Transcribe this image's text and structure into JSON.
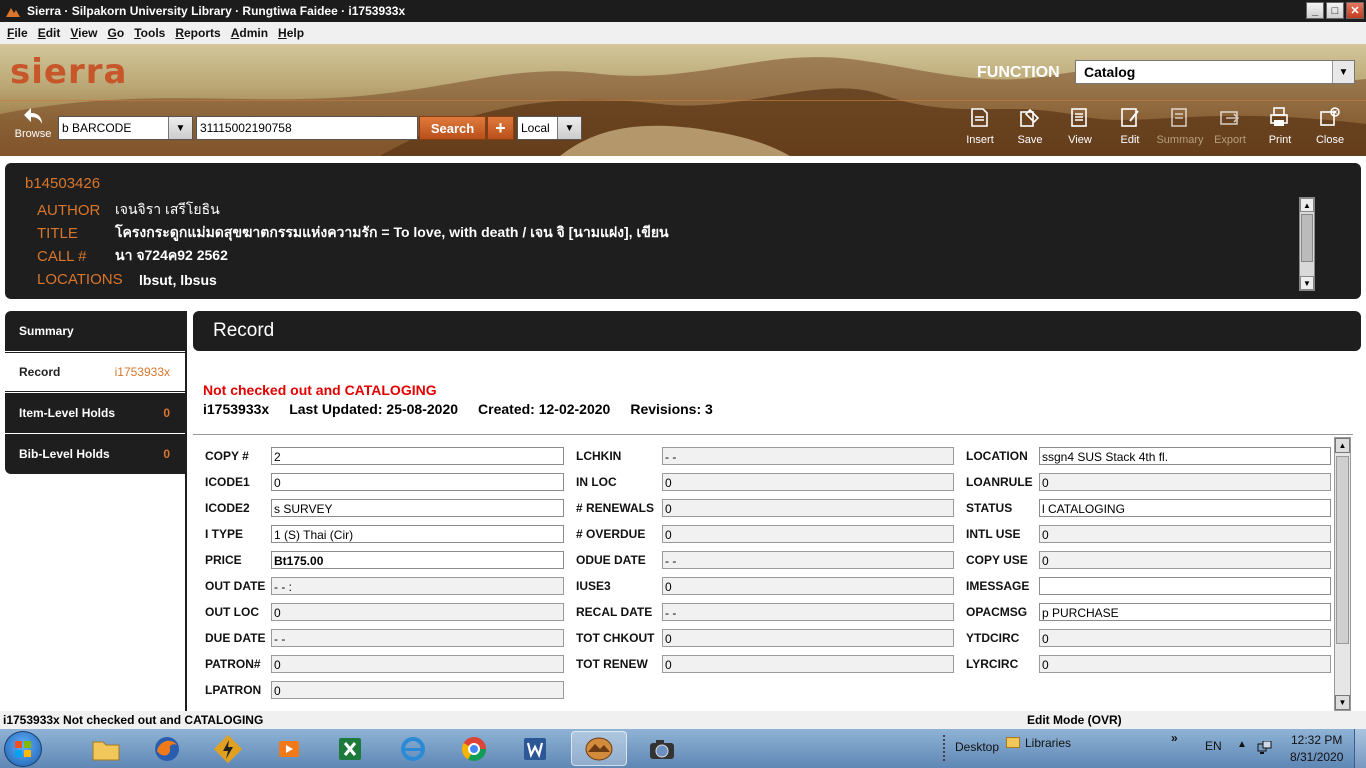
{
  "window": {
    "title": "Sierra · Silpakorn University Library · Rungtiwa Faidee · i1753933x",
    "min": "_",
    "max": "□",
    "close": "✕"
  },
  "menu": [
    {
      "label": "File",
      "key": "F"
    },
    {
      "label": "Edit",
      "key": "E"
    },
    {
      "label": "View",
      "key": "V"
    },
    {
      "label": "Go",
      "key": "G"
    },
    {
      "label": "Tools",
      "key": "T"
    },
    {
      "label": "Reports",
      "key": "R"
    },
    {
      "label": "Admin",
      "key": "A"
    },
    {
      "label": "Help",
      "key": "H"
    }
  ],
  "header": {
    "logo": "sierra",
    "function_label": "FUNCTION",
    "function_value": "Catalog",
    "browse_label": "Browse",
    "index_value": "b BARCODE",
    "search_value": "31115002190758",
    "search_button": "Search",
    "plus_button": "+",
    "scope_value": "Local",
    "toolbar": [
      {
        "label": "Insert",
        "icon": "insert-icon",
        "enabled": true
      },
      {
        "label": "Save",
        "icon": "save-icon",
        "enabled": true
      },
      {
        "label": "View",
        "icon": "view-icon",
        "enabled": true
      },
      {
        "label": "Edit",
        "icon": "edit-icon",
        "enabled": true
      },
      {
        "label": "Summary",
        "icon": "summary-icon",
        "enabled": false
      },
      {
        "label": "Export",
        "icon": "export-icon",
        "enabled": false
      },
      {
        "label": "Print",
        "icon": "print-icon",
        "enabled": true
      },
      {
        "label": "Close",
        "icon": "close-record-icon",
        "enabled": true
      }
    ]
  },
  "bib": {
    "number": "b14503426",
    "author_label": "AUTHOR",
    "author": "เจนจิรา เสรีโยธิน",
    "title_label": "TITLE",
    "title": "โครงกระดูกแม่มดสุขฆาตกรรมแห่งความรัก = To love, with death / เจน จิ [นามแฝง], เขียน",
    "call_label": "CALL #",
    "call": "นา จ724ค92 2562",
    "locations_label": "LOCATIONS",
    "locations": "lbsut, lbsus"
  },
  "nav": [
    {
      "label": "Summary",
      "count": ""
    },
    {
      "label": "Record",
      "count": "i1753933x"
    },
    {
      "label": "Item-Level Holds",
      "count": "0"
    },
    {
      "label": "Bib-Level Holds",
      "count": "0"
    }
  ],
  "record": {
    "header": "Record",
    "status": "Not checked out and CATALOGING",
    "item_id": "i1753933x",
    "last_updated": "Last Updated: 25-08-2020",
    "created": "Created: 12-02-2020",
    "revisions": "Revisions: 3",
    "col1": [
      {
        "label": "COPY #",
        "value": "2",
        "editable": true
      },
      {
        "label": "ICODE1",
        "value": "0",
        "editable": true
      },
      {
        "label": "ICODE2",
        "value": "s  SURVEY",
        "editable": true
      },
      {
        "label": "I TYPE",
        "value": "1  (S) Thai (Cir)",
        "editable": true
      },
      {
        "label": "PRICE",
        "value": "Bt175.00",
        "editable": true,
        "bold": true
      },
      {
        "label": "OUT DATE",
        "value": "-  -       :",
        "editable": false
      },
      {
        "label": "OUT LOC",
        "value": "0",
        "editable": false
      },
      {
        "label": "DUE DATE",
        "value": "-  -",
        "editable": false
      },
      {
        "label": "PATRON#",
        "value": "0",
        "editable": false
      },
      {
        "label": "LPATRON",
        "value": "0",
        "editable": false
      }
    ],
    "col2": [
      {
        "label": "LCHKIN",
        "value": "-  -",
        "editable": false
      },
      {
        "label": "IN LOC",
        "value": "0",
        "editable": false
      },
      {
        "label": "# RENEWALS",
        "value": "0",
        "editable": false
      },
      {
        "label": "# OVERDUE",
        "value": "0",
        "editable": false
      },
      {
        "label": "ODUE DATE",
        "value": "-  -",
        "editable": false
      },
      {
        "label": "IUSE3",
        "value": "0",
        "editable": false
      },
      {
        "label": "RECAL DATE",
        "value": "-  -",
        "editable": false
      },
      {
        "label": "TOT CHKOUT",
        "value": "0",
        "editable": false
      },
      {
        "label": "TOT RENEW",
        "value": "0",
        "editable": false
      }
    ],
    "col3": [
      {
        "label": "LOCATION",
        "value": "ssgn4  SUS Stack 4th fl.",
        "editable": true
      },
      {
        "label": "LOANRULE",
        "value": "0",
        "editable": false
      },
      {
        "label": "STATUS",
        "value": "l  CATALOGING",
        "editable": true
      },
      {
        "label": "INTL USE",
        "value": "0",
        "editable": false
      },
      {
        "label": "COPY USE",
        "value": "0",
        "editable": false
      },
      {
        "label": "IMESSAGE",
        "value": "",
        "editable": true
      },
      {
        "label": "OPACMSG",
        "value": "p  PURCHASE",
        "editable": true
      },
      {
        "label": "YTDCIRC",
        "value": "0",
        "editable": false
      },
      {
        "label": "LYRCIRC",
        "value": "0",
        "editable": false
      }
    ]
  },
  "statusbar": {
    "left": "i1753933x  Not checked out and CATALOGING",
    "right": "Edit Mode (OVR)"
  },
  "taskbar": {
    "desktop": "Desktop",
    "libraries": "Libraries",
    "chevron": "»",
    "lang": "EN",
    "time": "12:32 PM",
    "date": "8/31/2020"
  }
}
